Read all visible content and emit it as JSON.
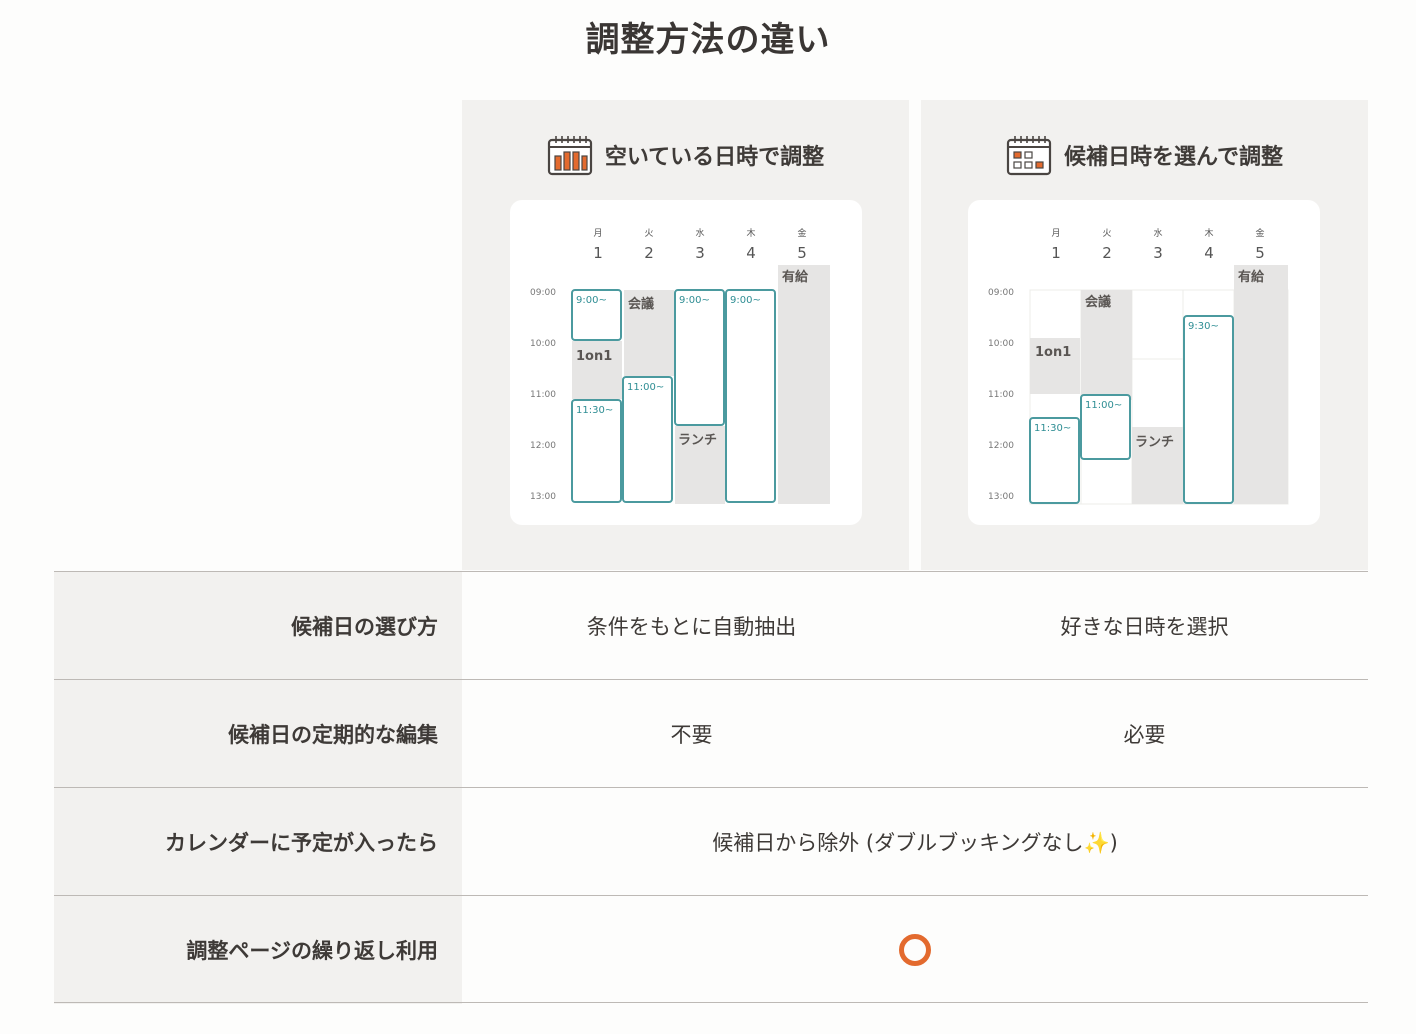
{
  "title": "調整方法の違い",
  "methods": [
    {
      "label": "空いている日時で調整",
      "icon": "calendar-bars-icon"
    },
    {
      "label": "候補日時を選んで調整",
      "icon": "calendar-grid-icon"
    }
  ],
  "calendar": {
    "days": [
      {
        "weekday": "月",
        "date": "1"
      },
      {
        "weekday": "火",
        "date": "2"
      },
      {
        "weekday": "水",
        "date": "3"
      },
      {
        "weekday": "木",
        "date": "4"
      },
      {
        "weekday": "金",
        "date": "5"
      }
    ],
    "times": [
      "09:00",
      "10:00",
      "11:00",
      "12:00",
      "13:00"
    ],
    "events": {
      "paid_leave": "有給",
      "meeting": "会議",
      "one_on_one": "1on1",
      "lunch": "ランチ"
    },
    "slots_a": [
      "9:00~",
      "11:30~",
      "11:00~",
      "9:00~",
      "9:00~"
    ],
    "slots_b": [
      "11:30~",
      "11:00~",
      "9:30~"
    ]
  },
  "rows": [
    {
      "label": "候補日の選び方",
      "a": "条件をもとに自動抽出",
      "b": "好きな日時を選択"
    },
    {
      "label": "候補日の定期的な編集",
      "a": "不要",
      "b": "必要"
    },
    {
      "label": "カレンダーに予定が入ったら",
      "merged": "候補日から除外 (ダブルブッキングなし✨)"
    },
    {
      "label": "調整ページの繰り返し利用",
      "merged_icon": "circle-mark-icon"
    }
  ],
  "colors": {
    "accent_teal": "#4b9a9f",
    "accent_orange": "#e36a2e",
    "panel_bg": "#f2f1ef",
    "busy_gray": "#e6e5e4"
  }
}
